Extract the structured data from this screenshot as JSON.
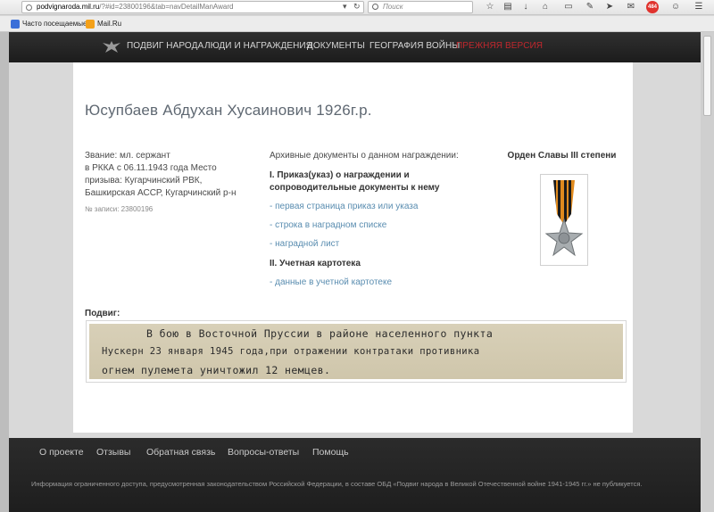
{
  "browser": {
    "url_host": "podvignaroda.mil.ru",
    "url_path": "/?#id=23800196&tab=navDetailManAward",
    "search_placeholder": "Поиск",
    "badge_count": "484"
  },
  "bookmarks": [
    {
      "label": "Часто посещаемые"
    },
    {
      "label": "Mail.Ru"
    }
  ],
  "nav": {
    "items": [
      "ПОДВИГ НАРОДА",
      "ЛЮДИ И НАГРАЖДЕНИЯ",
      "ДОКУМЕНТЫ",
      "ГЕОГРАФИЯ ВОЙНЫ"
    ],
    "old_version": "ПРЕЖНЯЯ ВЕРСИЯ"
  },
  "person": {
    "title": "Юсупбаев Абдухан Хусаинович 1926г.р.",
    "info_lines": [
      "Звание: мл. сержант",
      "в РККА с 06.11.1943 года Место",
      "призыва: Кугарчинский РВК,",
      "Башкирская АССР, Кугарчинский р-н"
    ],
    "record_no": "№ записи: 23800196"
  },
  "documents": {
    "caption": "Архивные документы о данном награждении:",
    "section1": "I. Приказ(указ) о награждении и сопроводительные документы к нему",
    "links1": [
      "- первая страница приказ или указа",
      "- строка в наградном списке",
      "- наградной лист"
    ],
    "section2": "II. Учетная картотека",
    "links2": [
      "- данные в учетной картотеке"
    ]
  },
  "award": {
    "title": "Орден Славы III степени",
    "ribbon_colors": [
      "#e08a1e",
      "#1a1a1a"
    ],
    "star_color": "#a8adb0"
  },
  "feat": {
    "label": "Подвиг:",
    "lines": [
      "В бою в Восточной Пруссии в районе населенного пункта",
      "Нускерн 23 января 1945 года,при отражении контратаки противника",
      "огнем пулемета уничтожил 12 немцев."
    ]
  },
  "footer": {
    "links": [
      "О проекте",
      "Отзывы",
      "Обратная связь",
      "Вопросы-ответы",
      "Помощь"
    ],
    "note": "Информация ограниченного доступа, предусмотренная законодательством Российской Федерации, в составе ОБД «Подвиг народа в Великой Отечественной войне 1941-1945 гг.» не публикуется."
  }
}
